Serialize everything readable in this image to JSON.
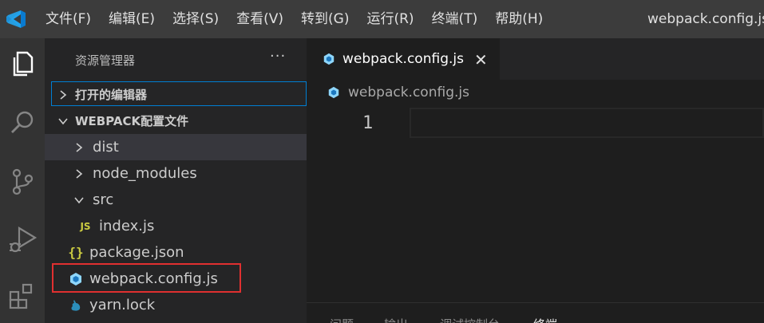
{
  "titlebar": {
    "menu": [
      "文件(F)",
      "编辑(E)",
      "选择(S)",
      "查看(V)",
      "转到(G)",
      "运行(R)",
      "终端(T)",
      "帮助(H)"
    ],
    "window_title": "webpack.config.js -"
  },
  "activity_bar": {
    "icons": [
      "files-icon",
      "search-icon",
      "source-control-icon",
      "run-debug-icon",
      "extensions-icon"
    ]
  },
  "sidebar": {
    "title": "资源管理器",
    "more": "···",
    "open_editors": "打开的编辑器",
    "workspace": "WEBPACK配置文件",
    "items": [
      {
        "label": "dist",
        "type": "folder",
        "expanded": false
      },
      {
        "label": "node_modules",
        "type": "folder",
        "expanded": false
      },
      {
        "label": "src",
        "type": "folder",
        "expanded": true
      },
      {
        "label": "index.js",
        "type": "js",
        "icon_text": "JS"
      },
      {
        "label": "package.json",
        "type": "json",
        "icon_text": "{}"
      },
      {
        "label": "webpack.config.js",
        "type": "webpack"
      },
      {
        "label": "yarn.lock",
        "type": "yarn"
      }
    ]
  },
  "editor": {
    "tab_label": "webpack.config.js",
    "tab_close": "✕",
    "breadcrumb": "webpack.config.js",
    "line_number": "1"
  },
  "panel": {
    "tabs": [
      "问题",
      "输出",
      "调试控制台",
      "终端"
    ]
  },
  "colors": {
    "titlebar": "#3c3c3c",
    "activitybar": "#333333",
    "sidebar": "#252526",
    "editor": "#1e1e1e",
    "focus": "#007fd4",
    "highlight_box": "#e03030",
    "webpack": "#8ed6fb"
  }
}
